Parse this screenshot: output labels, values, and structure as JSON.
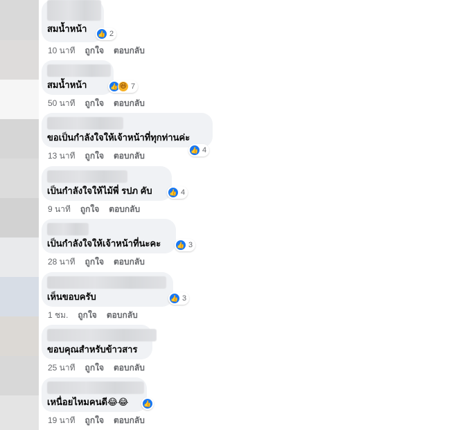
{
  "comments": [
    {
      "text": "สมน้ำหน้า",
      "reactions": [
        "like"
      ],
      "count": "2",
      "time": "10 นาที",
      "like": "ถูกใจ",
      "reply": "ตอบกลับ"
    },
    {
      "text": "สมน้ำหน้า",
      "reactions": [
        "like",
        "haha"
      ],
      "count": "7",
      "time": "50 นาที",
      "like": "ถูกใจ",
      "reply": "ตอบกลับ"
    },
    {
      "text": "ขอเป็นกำลังใจให้เจ้าหน้าที่ทุกท่านค่ะ",
      "reactions": [
        "like"
      ],
      "count": "4",
      "time": "13 นาที",
      "like": "ถูกใจ",
      "reply": "ตอบกลับ"
    },
    {
      "text": "เป็นกำลังใจให้ไม้พี่ รปภ คับ",
      "reactions": [
        "like"
      ],
      "count": "4",
      "time": "9 นาที",
      "like": "ถูกใจ",
      "reply": "ตอบกลับ"
    },
    {
      "text": "เป็นกำลังใจให้เจ้าหน้าที่นะคะ",
      "reactions": [
        "like"
      ],
      "count": "3",
      "time": "28 นาที",
      "like": "ถูกใจ",
      "reply": "ตอบกลับ"
    },
    {
      "text": "เห็นขอบครับ",
      "reactions": [
        "like"
      ],
      "count": "3",
      "time": "1 ชม.",
      "like": "ถูกใจ",
      "reply": "ตอบกลับ"
    },
    {
      "text": "ขอบคุณสำหรับข้าวสาร",
      "reactions": [],
      "count": "",
      "time": "25 นาที",
      "like": "ถูกใจ",
      "reply": "ตอบกลับ"
    },
    {
      "text": "เหนื่อยไหมคนดี😂😂",
      "reactions": [
        "like"
      ],
      "count": "",
      "time": "19 นาที",
      "like": "ถูกใจ",
      "reply": "ตอบกลับ"
    }
  ],
  "colors": {
    "bubble": "#f0f2f5",
    "like": "#1877f2",
    "haha": "#f7b125",
    "meta_text": "#65676b"
  }
}
